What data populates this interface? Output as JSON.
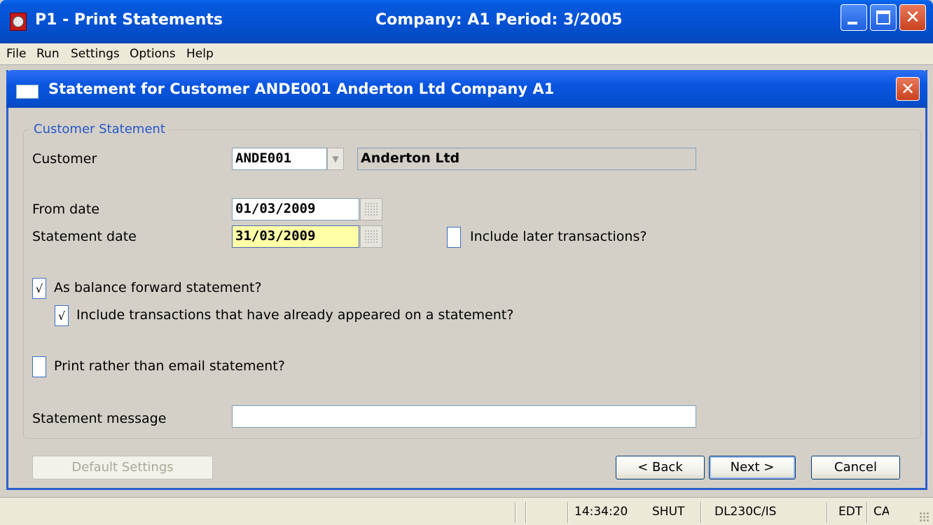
{
  "window": {
    "title": "P1 - Print Statements",
    "center_title": "Company: A1  Period:  3/2005"
  },
  "menu": [
    "File",
    "Run",
    "Settings",
    "Options",
    "Help"
  ],
  "dialog": {
    "title": "Statement for Customer ANDE001 Anderton Ltd Company A1",
    "group_label": "Customer Statement",
    "customer_label": "Customer",
    "customer_code": "ANDE001",
    "customer_name": "Anderton Ltd",
    "from_date_label": "From date",
    "from_date": "01/03/2009",
    "statement_date_label": "Statement date",
    "statement_date": "31/03/2009",
    "include_later_label": "Include later transactions?",
    "include_later_checked": false,
    "balance_forward_label": "As balance forward statement?",
    "balance_forward_checked": true,
    "include_appeared_label": "Include transactions that have already appeared on a statement?",
    "include_appeared_checked": true,
    "print_rather_label": "Print rather than email statement?",
    "print_rather_checked": false,
    "message_label": "Statement message",
    "message_value": "",
    "buttons": {
      "default_settings": "Default Settings",
      "back": "< Back",
      "next": "Next >",
      "cancel": "Cancel"
    },
    "check_mark": "√"
  },
  "status": {
    "time": "14:34:20",
    "mode": "SHUT",
    "server": "DL230C/IS",
    "edit": "EDT",
    "caps": "CA"
  },
  "colors": {
    "titlebar": "#0552d4",
    "dialog_border": "#2a5fcf",
    "group_label": "#2457c8",
    "focus_field": "#ffffa8",
    "window_bg": "#d4d0c8"
  }
}
